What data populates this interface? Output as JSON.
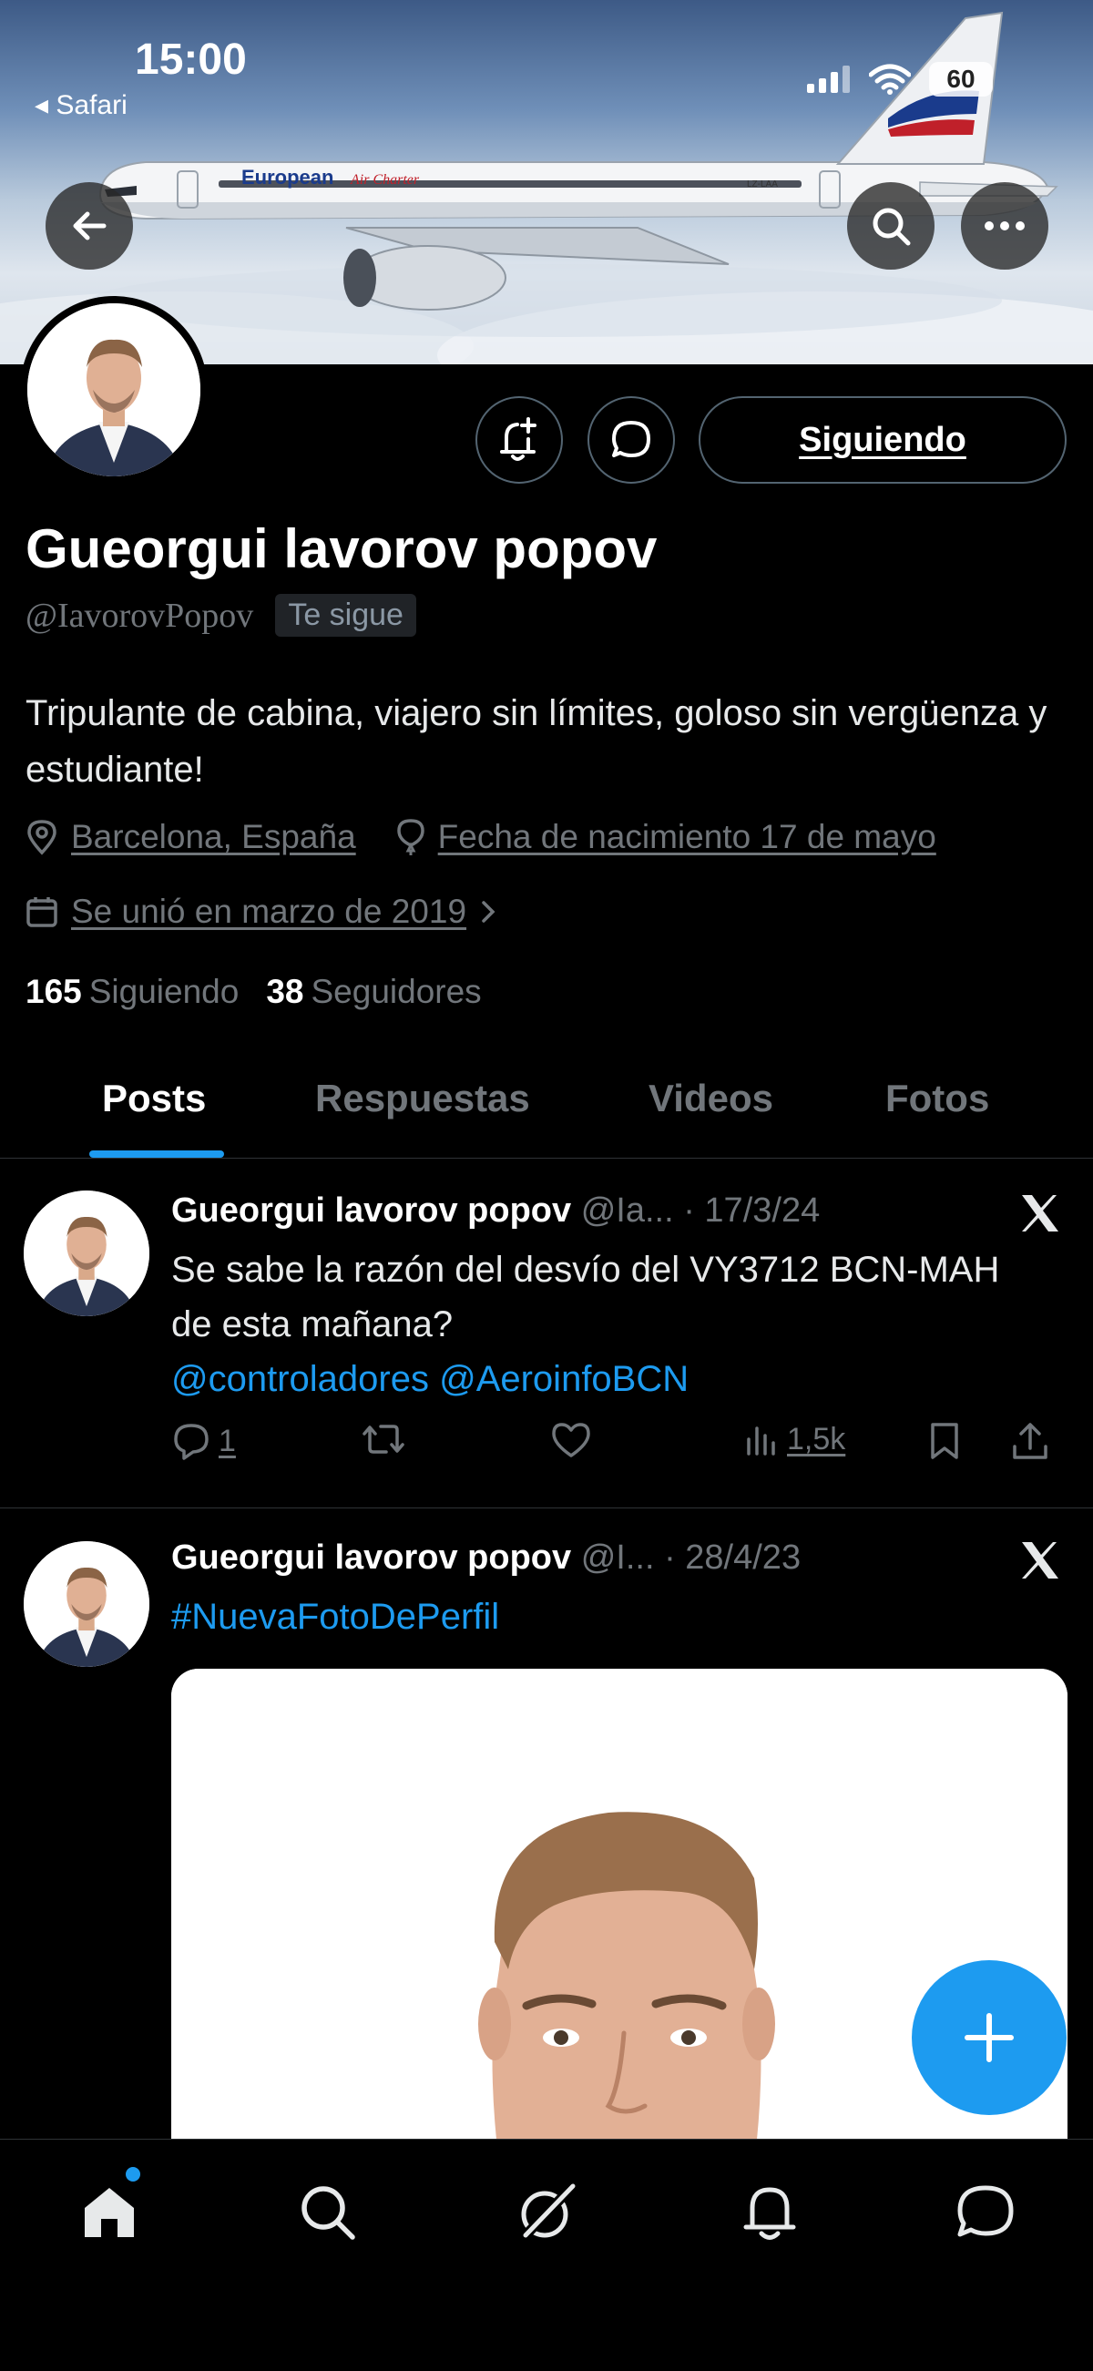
{
  "status_bar": {
    "time": "15:00",
    "back_app": "◂ Safari",
    "battery": "60"
  },
  "banner": {
    "airline_name": "European",
    "airline_script": "Air Charter",
    "registration": "LZ-LAA"
  },
  "profile": {
    "name": "Gueorgui lavorov popov",
    "handle": "@IavorovPopov",
    "follows_you": "Te sigue",
    "follow_button": "Siguiendo",
    "bio": "Tripulante de cabina, viajero sin límites, goloso sin vergüenza y estudiante!",
    "location": "Barcelona, España",
    "birthday": "Fecha de nacimiento 17 de mayo",
    "joined": "Se unió en marzo de 2019",
    "following_count": "165",
    "following_label": "Siguiendo",
    "followers_count": "38",
    "followers_label": "Seguidores"
  },
  "tabs": [
    {
      "label": "Posts",
      "active": true
    },
    {
      "label": "Respuestas",
      "active": false
    },
    {
      "label": "Videos",
      "active": false
    },
    {
      "label": "Fotos",
      "active": false
    }
  ],
  "posts": [
    {
      "author": "Gueorgui lavorov popov",
      "handle_date": "@Ia... · 17/3/24",
      "text": "Se sabe la razón del desvío del VY3712 BCN-MAH de esta mañana?",
      "mentions": "@controladores @AeroinfoBCN",
      "replies": "1",
      "views": "1,5k"
    },
    {
      "author": "Gueorgui lavorov popov",
      "handle_date": "@I... · 28/4/23",
      "hashtag": "#NuevaFotoDePerfil"
    }
  ],
  "colors": {
    "accent": "#1d9bf0",
    "background": "#000000",
    "muted": "#71767b",
    "border": "#2f3336"
  },
  "icons": [
    "back-arrow-icon",
    "search-icon",
    "more-icon",
    "notification-add-icon",
    "message-icon",
    "location-icon",
    "balloon-icon",
    "calendar-icon",
    "chevron-right-icon",
    "x-logo-icon",
    "reply-icon",
    "retweet-icon",
    "like-icon",
    "views-icon",
    "bookmark-icon",
    "share-icon",
    "plus-icon",
    "home-icon",
    "explore-icon",
    "grok-icon",
    "bell-icon",
    "messages-icon"
  ]
}
